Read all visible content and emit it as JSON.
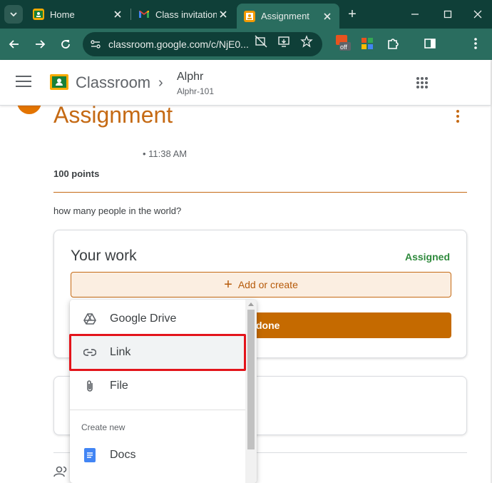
{
  "browser": {
    "tabs": [
      {
        "title": "Home",
        "favicon": "classroom-icon",
        "active": false
      },
      {
        "title": "Class invitation",
        "favicon": "gmail-icon",
        "active": false
      },
      {
        "title": "Assignment",
        "favicon": "assignment-icon",
        "active": true
      }
    ],
    "new_tab_label": "+",
    "url": "classroom.google.com/c/NjE0...",
    "extension_badge": "off",
    "colors": {
      "frame": "#0f3f38",
      "toolbar": "#2a6d5f"
    }
  },
  "header": {
    "app_name": "Classroom",
    "class_name": "Alphr",
    "class_section": "Alphr-101"
  },
  "assignment": {
    "title": "Assignment",
    "posted_time": "• 11:38 AM",
    "points": "100 points",
    "description": "how many people in the world?",
    "accent_color": "#c56a14"
  },
  "your_work": {
    "title": "Your work",
    "status": "Assigned",
    "add_button_label": "Add or create",
    "mark_done_label": "as done"
  },
  "add_menu": {
    "items": [
      {
        "label": "Google Drive",
        "icon": "google-drive-icon"
      },
      {
        "label": "Link",
        "icon": "link-icon"
      },
      {
        "label": "File",
        "icon": "paperclip-icon"
      }
    ],
    "section_label": "Create new",
    "create_items": [
      {
        "label": "Docs",
        "icon": "docs-icon"
      }
    ]
  }
}
